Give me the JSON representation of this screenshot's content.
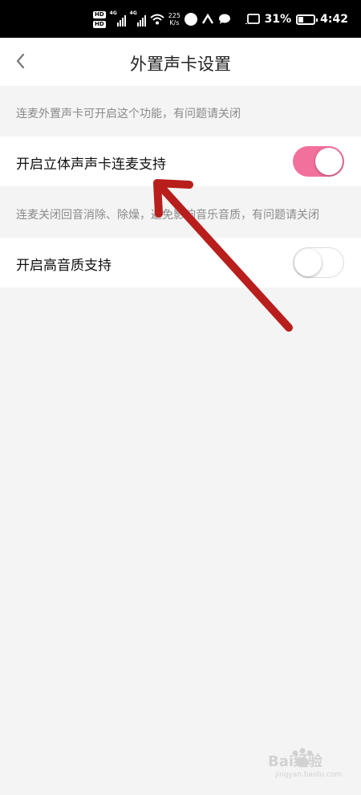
{
  "status_bar": {
    "hd_top": "HD",
    "hd_bottom": "HD",
    "net_1": "4G",
    "net_2": "4G",
    "speed_value": "225",
    "speed_unit": "K/s",
    "battery": "31%",
    "time": "4:42",
    "battery_level_percent": 31
  },
  "header": {
    "title": "外置声卡设置",
    "back_icon": "chevron-left-icon"
  },
  "settings": {
    "hint_1": "连麦外置声卡可开启这个功能，有问题请关闭",
    "stereo": {
      "label": "开启立体声声卡连麦支持",
      "enabled": true
    },
    "hint_2": "连麦关闭回音消除、除燥，避免影响音乐音质，有问题请关闭",
    "hq": {
      "label": "开启高音质支持",
      "enabled": false
    }
  },
  "colors": {
    "toggle_on": "#f2709c",
    "annotation_arrow": "#b81f1c"
  },
  "watermark": {
    "text": "Bai经验",
    "sub": "jingyan.baidu.com"
  }
}
